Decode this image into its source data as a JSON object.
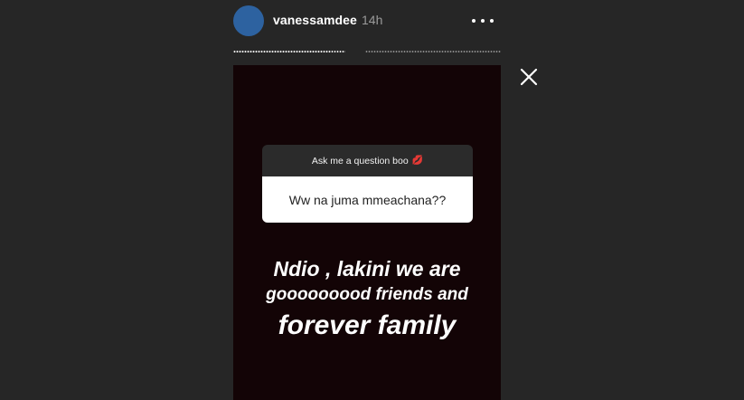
{
  "header": {
    "username": "vanessamdee",
    "time": "14h"
  },
  "progress": {
    "segments": [
      {
        "filled": 0.87
      },
      {
        "filled": 0.0
      }
    ]
  },
  "question_sticker": {
    "prompt": "Ask me a question boo",
    "prompt_emoji": "💋",
    "question": "Ww na juma mmeachana??"
  },
  "answer_text": {
    "line1": "Ndio , lakini we are",
    "line2": "gooooooood friends and",
    "line3": "forever family"
  },
  "icons": {
    "more": "more-options-icon",
    "close": "close-icon"
  },
  "colors": {
    "background": "#262626",
    "avatar": "#2d62a0",
    "story_bg": "#130406"
  }
}
